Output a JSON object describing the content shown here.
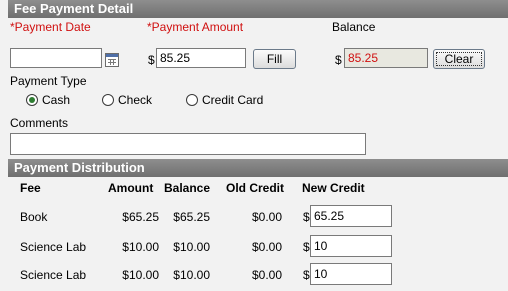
{
  "fee_payment": {
    "title": "Fee Payment Detail",
    "payment_date_label": "*Payment Date",
    "payment_date_value": "",
    "payment_amount_label": "*Payment Amount",
    "currency_symbol": "$",
    "payment_amount_value": "85.25",
    "fill_button": "Fill",
    "balance_label": "Balance",
    "balance_value": "85.25",
    "clear_button": "Clear",
    "payment_type_label": "Payment Type",
    "payment_types": [
      {
        "label": "Cash",
        "selected": true
      },
      {
        "label": "Check",
        "selected": false
      },
      {
        "label": "Credit Card",
        "selected": false
      }
    ],
    "comments_label": "Comments",
    "comments_value": ""
  },
  "distribution": {
    "title": "Payment Distribution",
    "columns": [
      "Fee",
      "Amount",
      "Balance",
      "Old Credit",
      "New Credit"
    ],
    "rows": [
      {
        "fee": "Book",
        "amount": "$65.25",
        "balance": "$65.25",
        "old_credit": "$0.00",
        "new_credit": "65.25"
      },
      {
        "fee": "Science Lab",
        "amount": "$10.00",
        "balance": "$10.00",
        "old_credit": "$0.00",
        "new_credit": "10"
      },
      {
        "fee": "Science Lab",
        "amount": "$10.00",
        "balance": "$10.00",
        "old_credit": "$0.00",
        "new_credit": "10"
      }
    ]
  },
  "colors": {
    "required_label": "#d01010",
    "header_bg": "#7f7f7f",
    "balance_text": "#d01010",
    "balance_bg": "#e8e8e0",
    "radio_selected": "#2e7d32"
  },
  "icons": [
    "calendar-icon"
  ]
}
